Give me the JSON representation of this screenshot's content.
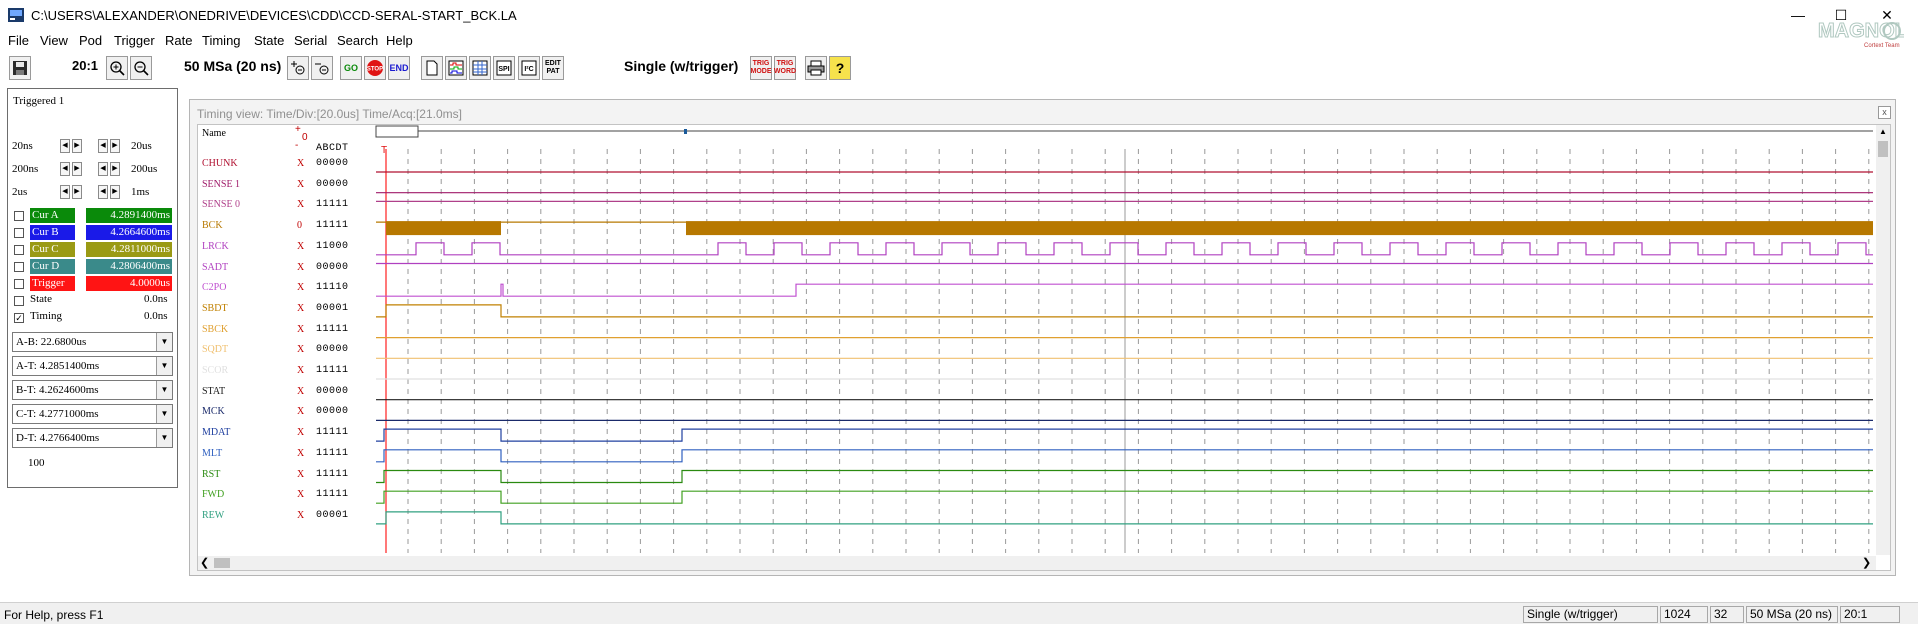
{
  "window": {
    "title": "C:\\USERS\\ALEXANDER\\ONEDRIVE\\DEVICES\\CDD\\CCD-SERAL-START_BCK.LA",
    "minimize": "—",
    "maximize": "☐",
    "close": "✕"
  },
  "menu": [
    "File",
    "View",
    "Pod",
    "Trigger",
    "Rate",
    "Timing",
    "State",
    "Serial",
    "Search",
    "Help"
  ],
  "toolbar": {
    "zoom": "20:1",
    "rate": "50 MSa  (20 ns)",
    "go": "GO",
    "stop": "STOP",
    "end": "END",
    "edit_pat": "EDIT PAT",
    "mode": "Single  (w/trigger)",
    "trig_mode": "TRIG MODE",
    "trig_word": "TRIG WORD",
    "help": "?"
  },
  "left_panel": {
    "triggered": "Triggered 1",
    "steps": [
      {
        "left": "20ns",
        "right": "20us"
      },
      {
        "left": "200ns",
        "right": "200us"
      },
      {
        "left": "2us",
        "right": "1ms"
      }
    ],
    "cursors": [
      {
        "name": "Cur A",
        "value": "4.2891400ms",
        "color": "#0a8a0a",
        "checked": false
      },
      {
        "name": "Cur B",
        "value": "4.2664600ms",
        "color": "#1a1ae8",
        "checked": false
      },
      {
        "name": "Cur C",
        "value": "4.2811000ms",
        "color": "#9a9a14",
        "checked": false
      },
      {
        "name": "Cur D",
        "value": "4.2806400ms",
        "color": "#3a8a8a",
        "checked": false
      },
      {
        "name": "Trigger",
        "value": "4.0000us",
        "color": "#ff1414",
        "checked": false
      }
    ],
    "state": {
      "label": "State",
      "value": "0.0ns",
      "checked": false
    },
    "timing": {
      "label": "Timing",
      "value": "0.0ns",
      "checked": true
    },
    "checkmark": "✓",
    "deltas": [
      "A-B: 22.6800us",
      "A-T: 4.2851400ms",
      "B-T: 4.2624600ms",
      "C-T: 4.2771000ms",
      "D-T: 4.2766400ms"
    ],
    "counter": "100"
  },
  "timing_view": {
    "title": "Timing view:  Time/Div:[20.0us] Time/Acq:[21.0ms]",
    "close": "x",
    "name_header": "Name",
    "polarity_plus": "+",
    "polarity_zero": "0",
    "polarity_minus": "-",
    "bits_header": "ABCDT",
    "trigger_marker": "T",
    "signals": [
      {
        "name": "CHUNK",
        "x": "X",
        "bits": "00000",
        "color": "#b01030"
      },
      {
        "name": "SENSE 1",
        "x": "X",
        "bits": "00000",
        "color": "#a01c6a"
      },
      {
        "name": "SENSE 0",
        "x": "X",
        "bits": "11111",
        "color": "#b0408a"
      },
      {
        "name": "BCK",
        "x": "0",
        "bits": "11111",
        "color": "#b77800"
      },
      {
        "name": "LRCK",
        "x": "X",
        "bits": "11000",
        "color": "#b040c0"
      },
      {
        "name": "SADT",
        "x": "X",
        "bits": "00000",
        "color": "#b040c0"
      },
      {
        "name": "C2PO",
        "x": "X",
        "bits": "11110",
        "color": "#c050d0"
      },
      {
        "name": "SBDT",
        "x": "X",
        "bits": "00001",
        "color": "#c08000"
      },
      {
        "name": "SBCK",
        "x": "X",
        "bits": "11111",
        "color": "#e0a030"
      },
      {
        "name": "SQDT",
        "x": "X",
        "bits": "00000",
        "color": "#f0c070"
      },
      {
        "name": "SCOR",
        "x": "X",
        "bits": "11111",
        "color": "#e0e0e0"
      },
      {
        "name": "STAT",
        "x": "X",
        "bits": "00000",
        "color": "#202020"
      },
      {
        "name": "MCK",
        "x": "X",
        "bits": "00000",
        "color": "#1a2a6a"
      },
      {
        "name": "MDAT",
        "x": "X",
        "bits": "11111",
        "color": "#2040a0"
      },
      {
        "name": "MLT",
        "x": "X",
        "bits": "11111",
        "color": "#3060c0"
      },
      {
        "name": "RST",
        "x": "X",
        "bits": "11111",
        "color": "#2a8a10"
      },
      {
        "name": "FWD",
        "x": "X",
        "bits": "11111",
        "color": "#40a020"
      },
      {
        "name": "REW",
        "x": "X",
        "bits": "00001",
        "color": "#30a080"
      }
    ],
    "scroll_left": "❮",
    "scroll_right": "❯"
  },
  "status_bar": {
    "help": "For Help, press F1",
    "mode": "Single (w/trigger)",
    "depth": "1024",
    "channels": "32",
    "rate": "50 MSa (20 ns)",
    "zoom": "20:1"
  }
}
